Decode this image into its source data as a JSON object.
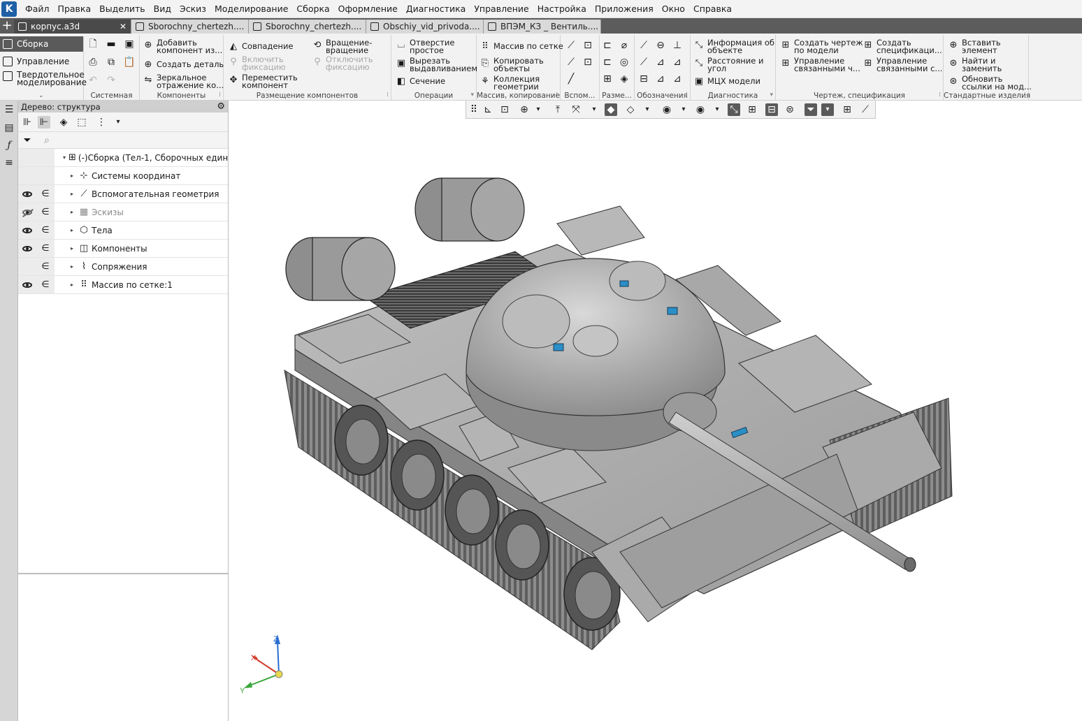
{
  "menu": [
    "Файл",
    "Правка",
    "Выделить",
    "Вид",
    "Эскиз",
    "Моделирование",
    "Сборка",
    "Оформление",
    "Диагностика",
    "Управление",
    "Настройка",
    "Приложения",
    "Окно",
    "Справка"
  ],
  "tabs": [
    {
      "label": "корпус.a3d",
      "close": "✕"
    },
    {
      "label": "Sborochny_chertezh...."
    },
    {
      "label": "Sborochny_chertezh...."
    },
    {
      "label": "Obschiy_vid_privoda...."
    },
    {
      "label": "ВПЭМ_КЗ _ Вентиль...."
    }
  ],
  "ribbon": {
    "sections": [
      "Сборка",
      "Управление",
      "Твердотельное моделирование"
    ],
    "groups": {
      "system": "Системная",
      "components": "Компоненты",
      "placement": "Размещение компонентов",
      "operations": "Операции",
      "array": "Массив, копирование",
      "aux": "Вспом...",
      "dims": "Разме...",
      "notation": "Обозначения",
      "diagnostics": "Диагностика",
      "drawing": "Чертеж, спецификация",
      "standard": "Стандартные изделия"
    },
    "buttons": {
      "add_component": [
        "Добавить",
        "компонент из..."
      ],
      "create_part": "Создать деталь",
      "mirror": [
        "Зеркальное",
        "отражение ко..."
      ],
      "coincidence": "Совпадение",
      "enable_fix": [
        "Включить",
        "фиксацию"
      ],
      "move_component": [
        "Переместить",
        "компонент"
      ],
      "rotate": [
        "Вращение-",
        "вращение"
      ],
      "disable_fix": [
        "Отключить",
        "фиксацию"
      ],
      "hole_simple": [
        "Отверстие",
        "простое"
      ],
      "cut_extrude": [
        "Вырезать",
        "выдавливанием"
      ],
      "section": "Сечение",
      "grid_array": "Массив по сетке",
      "copy_objects": [
        "Копировать",
        "объекты"
      ],
      "geometry_collection": [
        "Коллекция",
        "геометрии"
      ],
      "object_info": [
        "Информация об",
        "объекте"
      ],
      "distance_angle": [
        "Расстояние и",
        "угол"
      ],
      "mass_props": "МЦХ модели",
      "create_drawing": [
        "Создать чертеж",
        "по модели"
      ],
      "manage_linked_drawings": [
        "Управление",
        "связанными ч..."
      ],
      "create_spec": [
        "Создать",
        "спецификаци..."
      ],
      "manage_linked_specs": [
        "Управление",
        "связанными с..."
      ],
      "insert_element": [
        "Вставить",
        "элемент"
      ],
      "find_replace": [
        "Найти и",
        "заменить"
      ],
      "update_links": [
        "Обновить",
        "ссылки на мод..."
      ]
    }
  },
  "tree": {
    "title": "Дерево: структура",
    "search_placeholder": "",
    "rows": [
      {
        "label": "(-)Сборка (Тел-1, Сборочных един...",
        "vis": "",
        "inc": ""
      },
      {
        "label": "Системы координат",
        "vis": "",
        "inc": ""
      },
      {
        "label": "Вспомогательная геометрия",
        "vis": "on",
        "inc": "∈"
      },
      {
        "label": "Эскизы",
        "vis": "off",
        "inc": "∈",
        "muted": true
      },
      {
        "label": "Тела",
        "vis": "on",
        "inc": "∈"
      },
      {
        "label": "Компоненты",
        "vis": "on",
        "inc": "∈"
      },
      {
        "label": "Сопряжения",
        "vis": "",
        "inc": "∈"
      },
      {
        "label": "Массив по сетке:1",
        "vis": "on",
        "inc": "∈"
      }
    ]
  },
  "triad": {
    "x": "X",
    "y": "Y",
    "z": "Z"
  },
  "colors": {
    "accent": "#1f5fa5",
    "body": "#a9a9a9",
    "sight": "#2a8fc7"
  }
}
